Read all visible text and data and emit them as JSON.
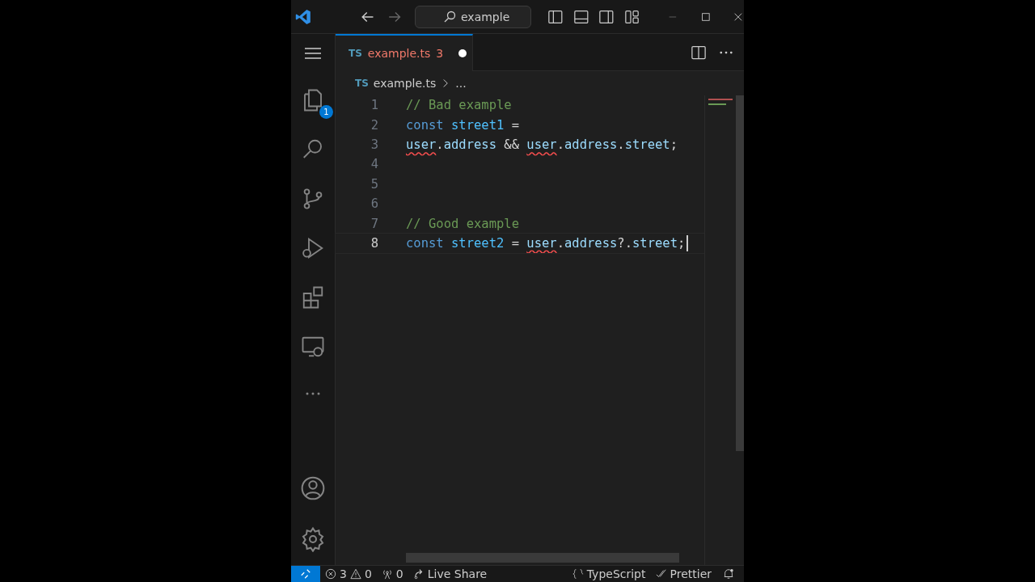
{
  "title_bar": {
    "search": "example"
  },
  "tabs": [
    {
      "icon": "TS",
      "label": "example.ts",
      "problems": "3",
      "modified": true,
      "selected": true
    }
  ],
  "breadcrumb": {
    "icon": "TS",
    "file": "example.ts",
    "more": "..."
  },
  "activity_bar": {
    "explorer_badge": "1"
  },
  "lines": [
    {
      "number": "1",
      "active": false,
      "tokens": [
        {
          "text": "// Bad example",
          "kind": "comment",
          "squiggle": false
        }
      ]
    },
    {
      "number": "2",
      "active": false,
      "tokens": [
        {
          "text": "const ",
          "kind": "keyword",
          "squiggle": false
        },
        {
          "text": "street1",
          "kind": "const",
          "squiggle": false
        },
        {
          "text": " =",
          "kind": "text",
          "squiggle": false
        }
      ]
    },
    {
      "number": "3",
      "active": false,
      "tokens": [
        {
          "text": "user",
          "kind": "var",
          "squiggle": true
        },
        {
          "text": ".",
          "kind": "text",
          "squiggle": false
        },
        {
          "text": "address",
          "kind": "var",
          "squiggle": false
        },
        {
          "text": " && ",
          "kind": "text",
          "squiggle": false
        },
        {
          "text": "user",
          "kind": "var",
          "squiggle": true
        },
        {
          "text": ".",
          "kind": "text",
          "squiggle": false
        },
        {
          "text": "address",
          "kind": "var",
          "squiggle": false
        },
        {
          "text": ".",
          "kind": "text",
          "squiggle": false
        },
        {
          "text": "street",
          "kind": "var",
          "squiggle": false
        },
        {
          "text": ";",
          "kind": "text",
          "squiggle": false
        }
      ]
    },
    {
      "number": "4",
      "active": false
    },
    {
      "number": "5",
      "active": false
    },
    {
      "number": "6",
      "active": false
    },
    {
      "number": "7",
      "active": false,
      "tokens": [
        {
          "text": "// Good example",
          "kind": "comment",
          "squiggle": false
        }
      ]
    },
    {
      "number": "8",
      "active": true,
      "tokens": [
        {
          "text": "const ",
          "kind": "keyword",
          "squiggle": false
        },
        {
          "text": "street2",
          "kind": "const",
          "squiggle": false
        },
        {
          "text": " = ",
          "kind": "text",
          "squiggle": false
        },
        {
          "text": "user",
          "kind": "var",
          "squiggle": true
        },
        {
          "text": ".",
          "kind": "text",
          "squiggle": false
        },
        {
          "text": "address",
          "kind": "var",
          "squiggle": false
        },
        {
          "text": "?.",
          "kind": "text",
          "squiggle": false
        },
        {
          "text": "street",
          "kind": "var",
          "squiggle": false
        },
        {
          "text": ";",
          "kind": "text",
          "squiggle": false
        }
      ]
    }
  ],
  "status_bar": {
    "errors": "3",
    "warnings": "0",
    "ports": "0",
    "live_share": "Live Share",
    "language": "TypeScript",
    "formatter": "Prettier"
  }
}
